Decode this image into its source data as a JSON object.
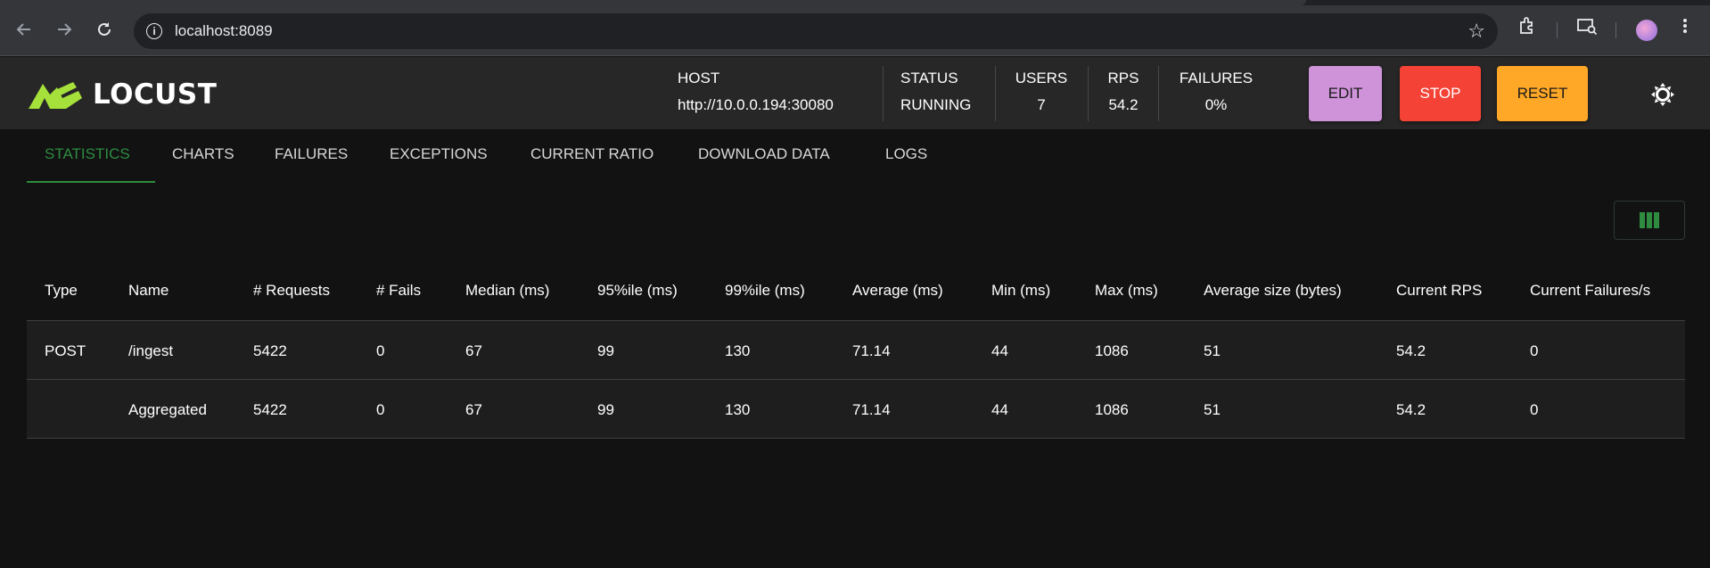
{
  "browser": {
    "url": "localhost:8089"
  },
  "app": {
    "name": "LOCUST",
    "stats": {
      "host_label": "HOST",
      "host_value": "http://10.0.0.194:30080",
      "status_label": "STATUS",
      "status_value": "RUNNING",
      "users_label": "USERS",
      "users_value": "7",
      "rps_label": "RPS",
      "rps_value": "54.2",
      "failures_label": "FAILURES",
      "failures_value": "0%"
    },
    "buttons": {
      "edit": "EDIT",
      "stop": "STOP",
      "reset": "RESET"
    },
    "colors": {
      "accent_green": "#2e8b40",
      "edit": "#ce93d8",
      "stop": "#f44336",
      "reset": "#ffa726",
      "logo": "#a5e13a"
    }
  },
  "tabs": [
    {
      "label": "STATISTICS",
      "active": true
    },
    {
      "label": "CHARTS",
      "active": false
    },
    {
      "label": "FAILURES",
      "active": false
    },
    {
      "label": "EXCEPTIONS",
      "active": false
    },
    {
      "label": "CURRENT RATIO",
      "active": false
    },
    {
      "label": "DOWNLOAD DATA",
      "active": false
    },
    {
      "label": "LOGS",
      "active": false
    }
  ],
  "table": {
    "columns": [
      "Type",
      "Name",
      "# Requests",
      "# Fails",
      "Median (ms)",
      "95%ile (ms)",
      "99%ile (ms)",
      "Average (ms)",
      "Min (ms)",
      "Max (ms)",
      "Average size (bytes)",
      "Current RPS",
      "Current Failures/s"
    ],
    "rows": [
      [
        "POST",
        "/ingest",
        "5422",
        "0",
        "67",
        "99",
        "130",
        "71.14",
        "44",
        "1086",
        "51",
        "54.2",
        "0"
      ],
      [
        "",
        "Aggregated",
        "5422",
        "0",
        "67",
        "99",
        "130",
        "71.14",
        "44",
        "1086",
        "51",
        "54.2",
        "0"
      ]
    ]
  }
}
